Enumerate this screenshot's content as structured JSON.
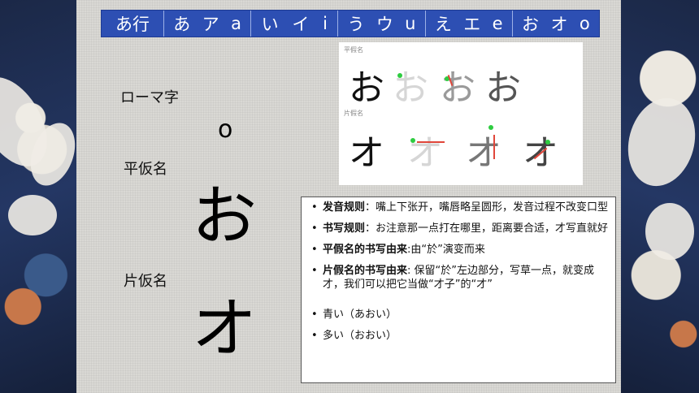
{
  "header_row": {
    "row_label": "あ行",
    "cells": [
      {
        "hira": "あ",
        "kata": "ア",
        "roma": "a"
      },
      {
        "hira": "い",
        "kata": "イ",
        "roma": "i"
      },
      {
        "hira": "う",
        "kata": "ウ",
        "roma": "u"
      },
      {
        "hira": "え",
        "kata": "エ",
        "roma": "e"
      },
      {
        "hira": "お",
        "kata": "オ",
        "roma": "o"
      }
    ]
  },
  "left_labels": {
    "romaji_label": "ローマ字",
    "romaji_value": "o",
    "hiragana_label": "平仮名",
    "hiragana_value": "お",
    "katakana_label": "片仮名",
    "katakana_value": "オ"
  },
  "stroke_order": {
    "hira_title": "平假名",
    "kata_title": "片假名",
    "hira_char": "お",
    "kata_char": "オ"
  },
  "notes": [
    {
      "title": "发音规则",
      "sep": "：",
      "text": "嘴上下张开，嘴唇略呈圆形，发音过程不改变口型"
    },
    {
      "title": "书写规则",
      "sep": "：",
      "text": "お注意那一点打在哪里，距离要合适，才写直就好"
    },
    {
      "title": "平假名的书写由来",
      "sep": ":",
      "text": "由“於”演变而来"
    },
    {
      "title": "片假名的书写由来",
      "sep": ": ",
      "text": "保留“於”左边部分，写草一点，就变成才，我们可以把它当做“才子”的“才”"
    }
  ],
  "vocab": [
    "青い（あおい）",
    "多い（おおい）"
  ],
  "colors": {
    "header_bg": "#2d4fb3",
    "panel_bg": "#d9d8d4",
    "stroke_dot": "#2ecc40",
    "stroke_line": "#e0463a"
  }
}
